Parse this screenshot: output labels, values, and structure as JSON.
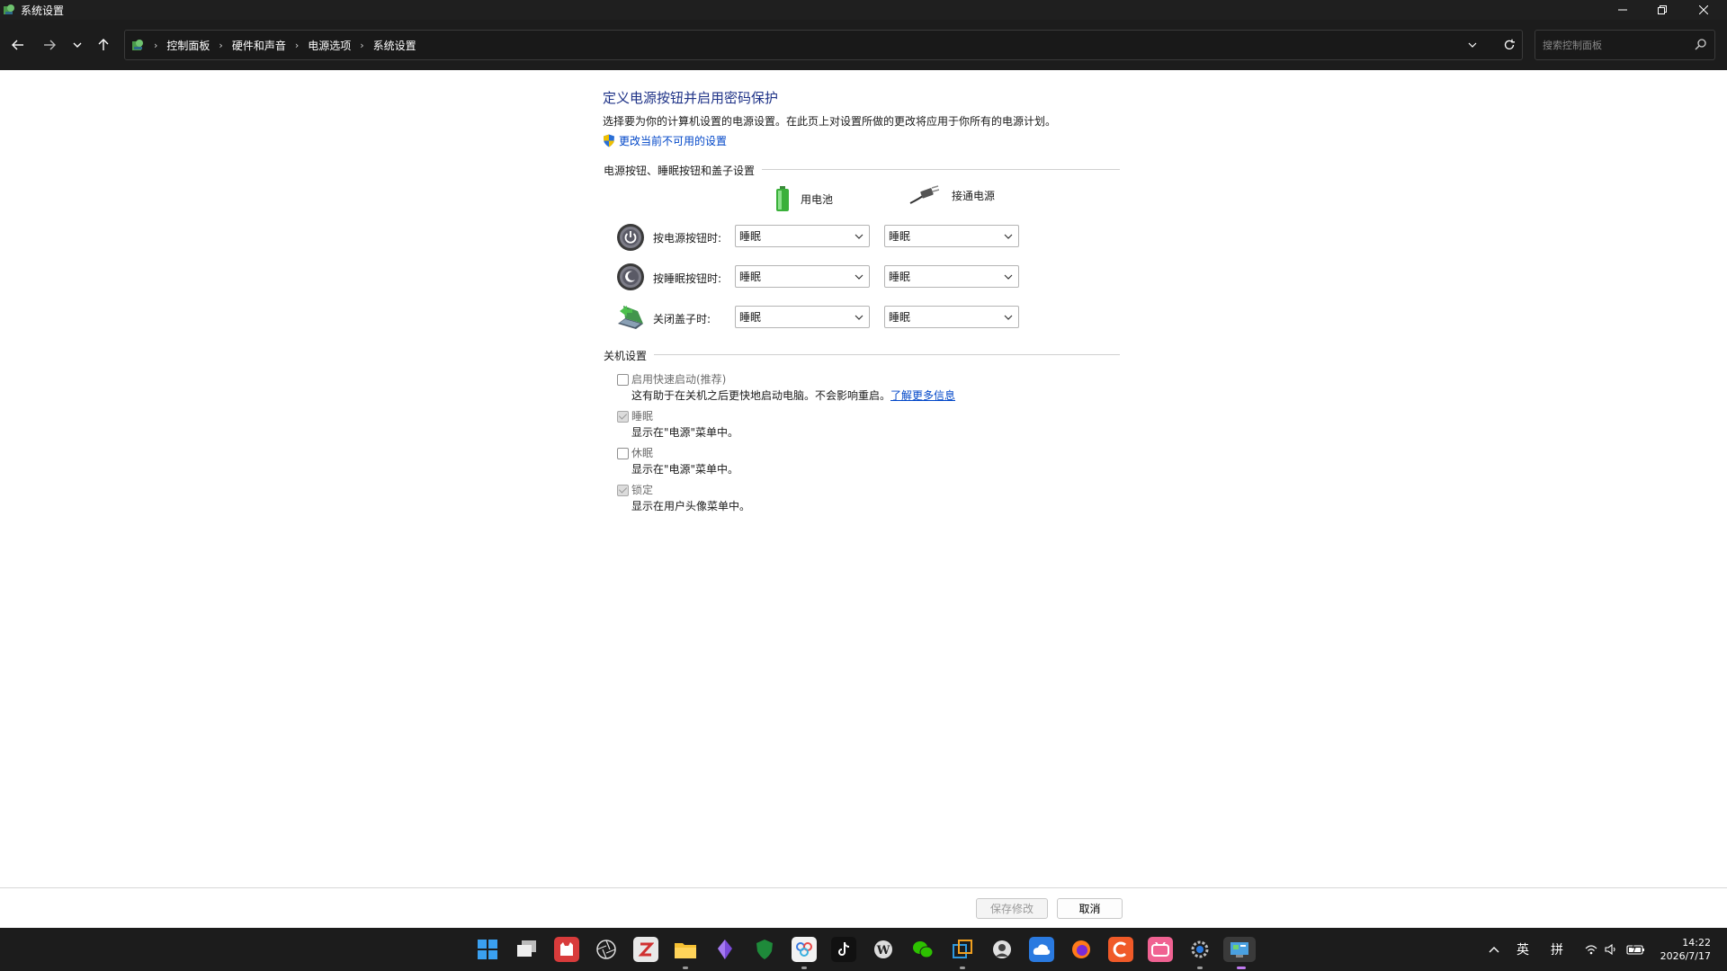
{
  "window": {
    "title": "系统设置"
  },
  "breadcrumbs": [
    "控制面板",
    "硬件和声音",
    "电源选项",
    "系统设置"
  ],
  "search": {
    "placeholder": "搜索控制面板"
  },
  "page": {
    "heading": "定义电源按钮并启用密码保护",
    "description": "选择要为你的计算机设置的电源设置。在此页上对设置所做的更改将应用于你所有的电源计划。",
    "change_link": "更改当前不可用的设置"
  },
  "power_section": {
    "title": "电源按钮、睡眠按钮和盖子设置",
    "col_battery": "用电池",
    "col_ac": "接通电源",
    "rows": [
      {
        "label": "按电源按钮时:",
        "battery": "睡眠",
        "ac": "睡眠"
      },
      {
        "label": "按睡眠按钮时:",
        "battery": "睡眠",
        "ac": "睡眠"
      },
      {
        "label": "关闭盖子时:",
        "battery": "睡眠",
        "ac": "睡眠"
      }
    ]
  },
  "shutdown_section": {
    "title": "关机设置",
    "items": [
      {
        "label": "启用快速启动(推荐)",
        "desc": "这有助于在关机之后更快地启动电脑。不会影响重启。",
        "link": "了解更多信息",
        "checked": false,
        "disabled": false
      },
      {
        "label": "睡眠",
        "desc": "显示在\"电源\"菜单中。",
        "checked": true,
        "disabled": true
      },
      {
        "label": "休眠",
        "desc": "显示在\"电源\"菜单中。",
        "checked": false,
        "disabled": false
      },
      {
        "label": "锁定",
        "desc": "显示在用户头像菜单中。",
        "checked": true,
        "disabled": true
      }
    ]
  },
  "footer": {
    "save_label": "保存修改",
    "cancel_label": "取消"
  },
  "tray": {
    "lang1": "英",
    "lang2": "拼",
    "time": "14:22",
    "date": "2026/7/17"
  },
  "colors": {
    "heading": "#1e3287",
    "link": "#0046c8",
    "titlebar": "#1f1f1f",
    "taskbar": "#1c1c1c"
  }
}
